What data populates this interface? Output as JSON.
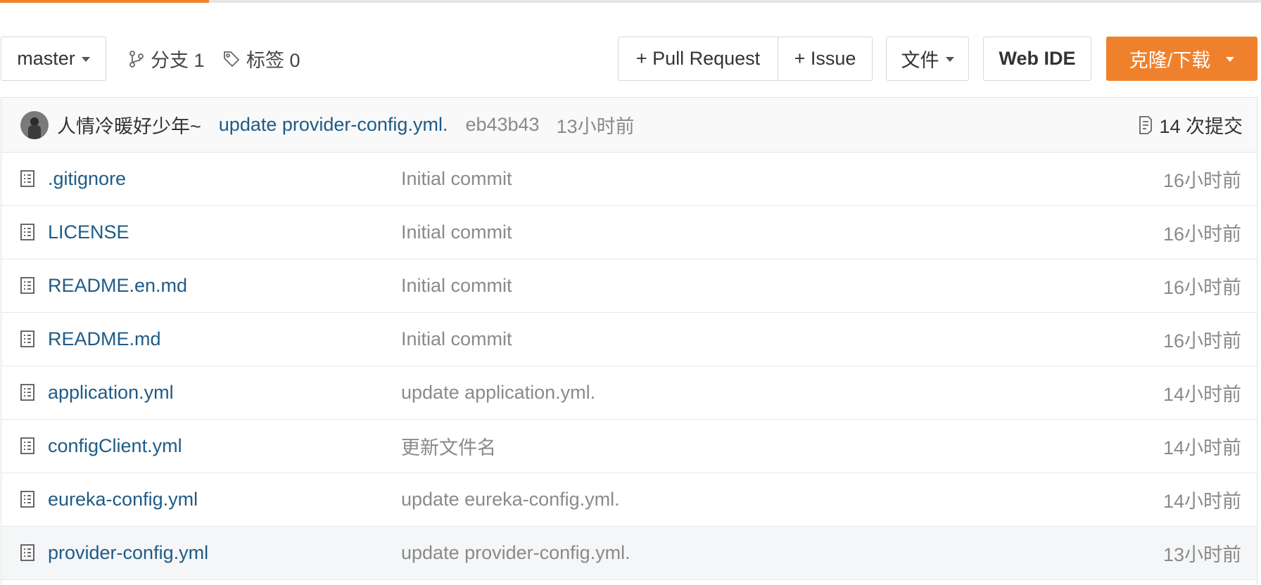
{
  "progress": {
    "percent": 16.6
  },
  "toolbar": {
    "branch_select": "master",
    "branches_label": "分支 1",
    "tags_label": "标签 0",
    "pull_request_label": "+ Pull Request",
    "issue_label": "+ Issue",
    "file_menu_label": "文件",
    "web_ide_label": "Web IDE",
    "clone_label": "克隆/下载"
  },
  "latest_commit": {
    "author": "人情冷暖好少年~",
    "message": "update provider-config.yml.",
    "hash": "eb43b43",
    "time": "13小时前",
    "count_label": "14 次提交"
  },
  "files": [
    {
      "name": ".gitignore",
      "commit": "Initial commit",
      "time": "16小时前"
    },
    {
      "name": "LICENSE",
      "commit": "Initial commit",
      "time": "16小时前"
    },
    {
      "name": "README.en.md",
      "commit": "Initial commit",
      "time": "16小时前"
    },
    {
      "name": "README.md",
      "commit": "Initial commit",
      "time": "16小时前"
    },
    {
      "name": "application.yml",
      "commit": "update application.yml.",
      "time": "14小时前"
    },
    {
      "name": "configClient.yml",
      "commit": "更新文件名",
      "time": "14小时前"
    },
    {
      "name": "eureka-config.yml",
      "commit": "update eureka-config.yml.",
      "time": "14小时前"
    },
    {
      "name": "provider-config.yml",
      "commit": "update provider-config.yml.",
      "time": "13小时前"
    }
  ],
  "colors": {
    "accent": "#f0812c",
    "link": "#1f5b86",
    "muted": "#8a8a8a"
  }
}
